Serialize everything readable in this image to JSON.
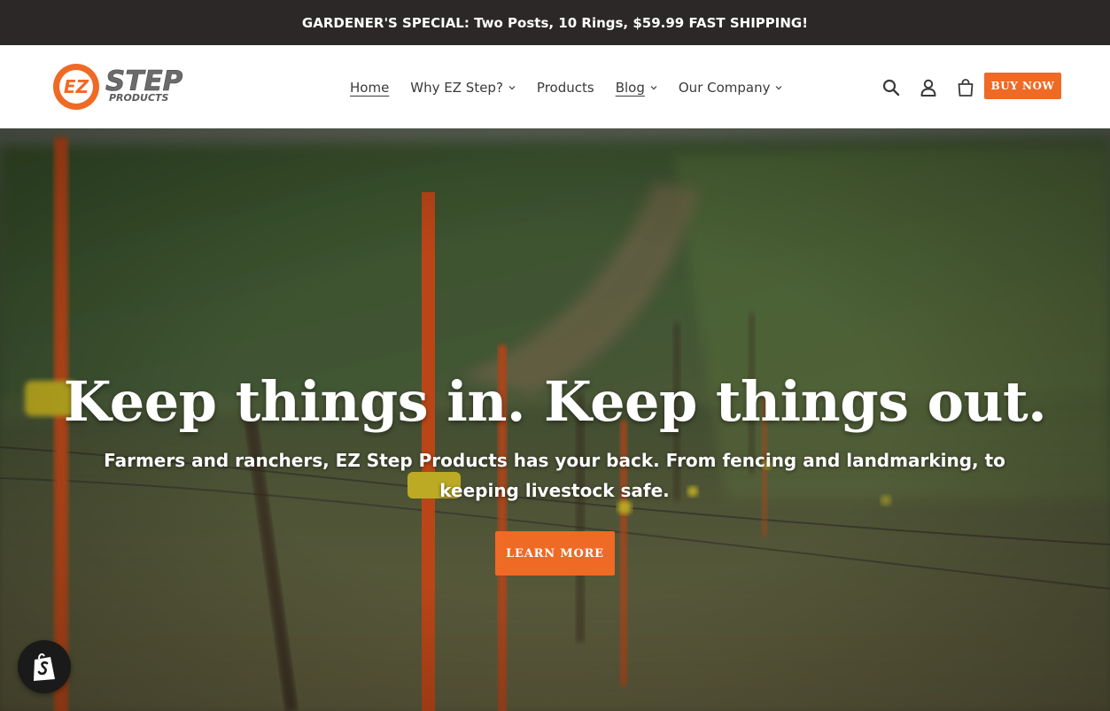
{
  "announcement": {
    "text": "GARDENER'S SPECIAL: Two Posts, 10 Rings, $59.99 FAST SHIPPING!"
  },
  "header": {
    "logo": {
      "text_main": "STEP",
      "text_sub": "PRODUCTS",
      "badge": "EZ"
    },
    "nav": [
      {
        "label": "Home",
        "has_dropdown": false,
        "active": true
      },
      {
        "label": "Why EZ Step?",
        "has_dropdown": true,
        "active": false
      },
      {
        "label": "Products",
        "has_dropdown": false,
        "active": false
      },
      {
        "label": "Blog",
        "has_dropdown": true,
        "active": true
      },
      {
        "label": "Our Company",
        "has_dropdown": true,
        "active": false
      }
    ],
    "icons": [
      "search-icon",
      "account-icon",
      "cart-icon"
    ],
    "buy_button": "BUY NOW"
  },
  "hero": {
    "title": "Keep things in. Keep things out.",
    "subtitle": "Farmers and ranchers, EZ Step Products has your back. From fencing and landmarking, to keeping livestock safe.",
    "cta": "LEARN MORE"
  },
  "colors": {
    "accent": "#ef6a25",
    "announcement_bg": "#2b2827",
    "text": "#3a3a3a"
  }
}
